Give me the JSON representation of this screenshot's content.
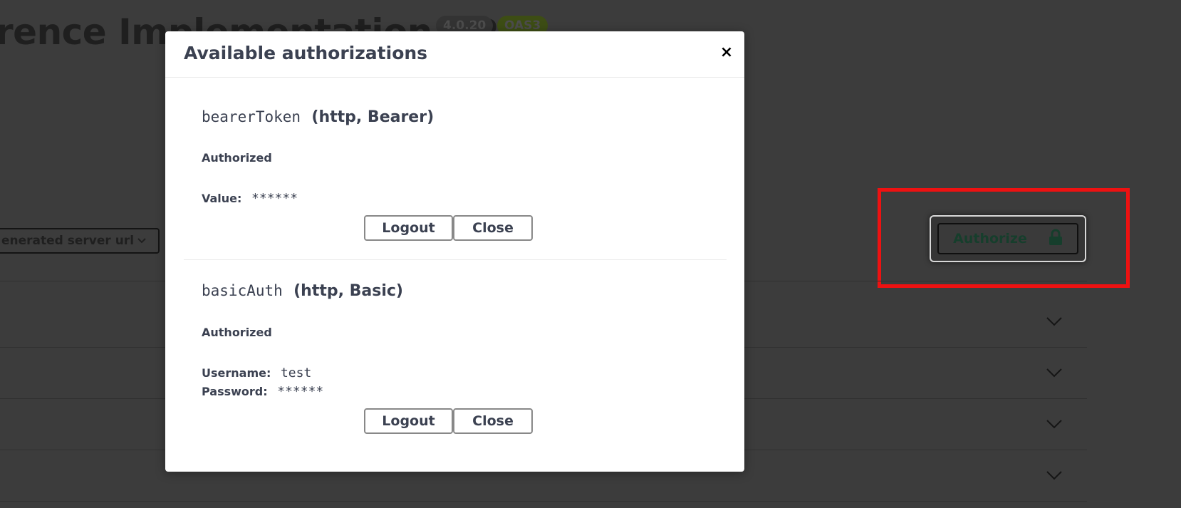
{
  "background": {
    "title": "rence Implementation API",
    "version_badge": "4.0.20",
    "oas_badge": "OAS3",
    "server_select": "enerated server url",
    "authorize_button": "Authorize"
  },
  "modal": {
    "title": "Available authorizations",
    "close_symbol": "×",
    "sections": [
      {
        "name": "bearerToken",
        "type": "(http, Bearer)",
        "status": "Authorized",
        "fields": [
          {
            "label": "Value:",
            "value": "******"
          }
        ],
        "logout_label": "Logout",
        "close_label": "Close"
      },
      {
        "name": "basicAuth",
        "type": "(http, Basic)",
        "status": "Authorized",
        "fields": [
          {
            "label": "Username:",
            "value": "test"
          },
          {
            "label": "Password:",
            "value": "******"
          }
        ],
        "logout_label": "Logout",
        "close_label": "Close"
      }
    ]
  },
  "colors": {
    "overlay": "#3c3c3c",
    "highlight": "#ee1111",
    "text": "#3b4151"
  },
  "icons": {
    "lock": "lock-icon",
    "chevron": "chevron-down-icon"
  }
}
